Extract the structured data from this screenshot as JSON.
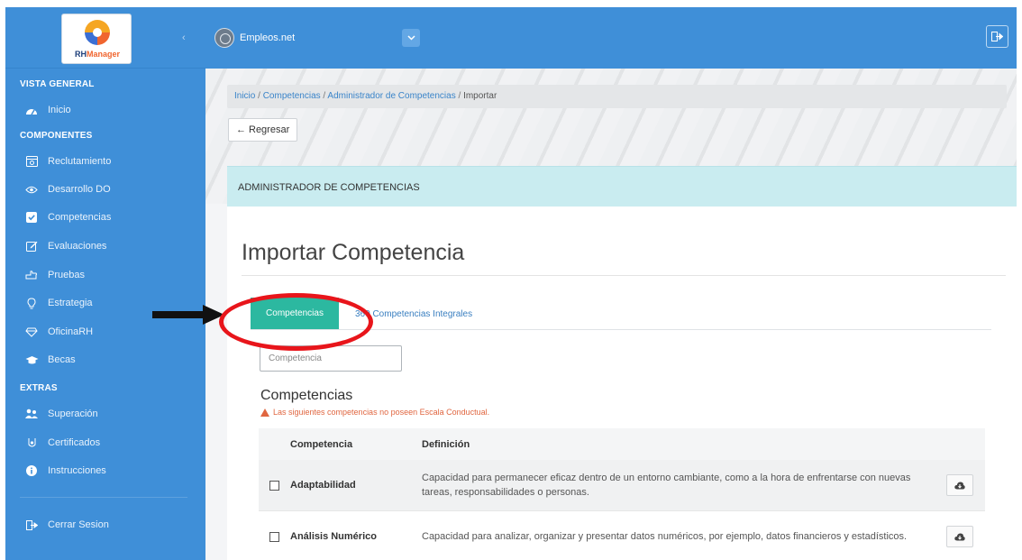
{
  "sidebar": {
    "logo_text_a": "RH",
    "logo_text_b": "Manager",
    "sections": {
      "general": "VISTA GENERAL",
      "components": "COMPONENTES",
      "extras": "EXTRAS"
    },
    "items": [
      {
        "label": "Inicio",
        "icon": "dashboard-icon"
      },
      {
        "label": "Reclutamiento",
        "icon": "browser-icon"
      },
      {
        "label": "Desarrollo DO",
        "icon": "eye-icon"
      },
      {
        "label": "Competencias",
        "icon": "checkbox-icon"
      },
      {
        "label": "Evaluaciones",
        "icon": "edit-icon"
      },
      {
        "label": "Pruebas",
        "icon": "hand-icon"
      },
      {
        "label": "Estrategia",
        "icon": "lightbulb-icon"
      },
      {
        "label": "OficinaRH",
        "icon": "diamond-icon"
      },
      {
        "label": "Becas",
        "icon": "graduation-cap-icon"
      },
      {
        "label": "Superación",
        "icon": "users-icon"
      },
      {
        "label": "Certificados",
        "icon": "certificate-icon"
      },
      {
        "label": "Instrucciones",
        "icon": "info-icon"
      }
    ],
    "logout": "Cerrar Sesion"
  },
  "topbar": {
    "company": "Empleos.net"
  },
  "breadcrumb": {
    "items": [
      "Inicio",
      "Competencias",
      "Administrador de Competencias"
    ],
    "current": "Importar",
    "separator": "/"
  },
  "back_button": "Regresar",
  "panel": {
    "header": "ADMINISTRADOR DE COMPETENCIAS",
    "title": "Importar Competencia",
    "tabs": {
      "active": "Competencias",
      "other": "360 Competencias Integrales"
    },
    "search_placeholder": "Competencia",
    "section_title": "Competencias",
    "warning": "Las siguientes competencias no poseen Escala Conductual."
  },
  "table": {
    "headers": [
      "Competencia",
      "Definición"
    ],
    "rows": [
      {
        "name": "Adaptabilidad",
        "definition": "Capacidad para permanecer eficaz dentro de un entorno cambiante, como a la hora de enfrentarse con nuevas tareas, responsabilidades o personas."
      },
      {
        "name": "Análisis Numérico",
        "definition": "Capacidad para analizar, organizar y presentar datos numéricos, por ejemplo, datos financieros y estadísticos."
      }
    ]
  },
  "colors": {
    "sidebar": "#3f8fd8",
    "tab_active": "#2cb8a0",
    "panel_header": "#c9ecf0",
    "warning": "#e06640",
    "annotation": "#e8151b"
  }
}
